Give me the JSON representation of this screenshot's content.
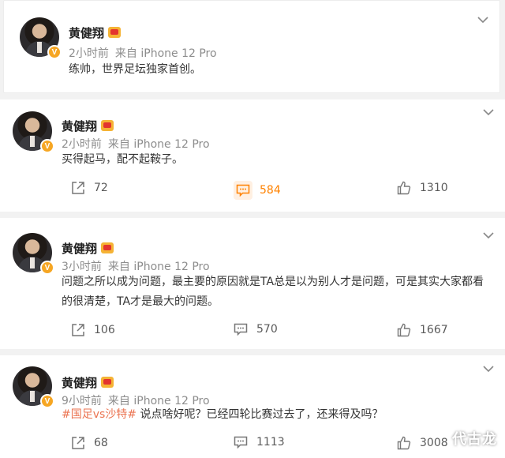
{
  "posts": [
    {
      "author": "黄健翔",
      "time": "2小时前",
      "source": "来自 iPhone 12 Pro",
      "content": "练帅，世界足坛独家首创。"
    },
    {
      "author": "黄健翔",
      "time": "2小时前",
      "source": "来自 iPhone 12 Pro",
      "content": "买得起马，配不起鞍子。",
      "shares": "72",
      "comments": "584",
      "likes": "1310"
    },
    {
      "author": "黄健翔",
      "time": "3小时前",
      "source": "来自 iPhone 12 Pro",
      "content_line1": "问题之所以成为问题，最主要的原因就是TA总是以为别人才是问题，可是其实大家都看",
      "content_line2": "的很清楚，TA才是最大的问题。",
      "shares": "106",
      "comments": "570",
      "likes": "1667"
    },
    {
      "author": "黄健翔",
      "time": "9小时前",
      "source": "来自 iPhone 12 Pro",
      "topic": "#国足vs沙特#",
      "content": " 说点啥好呢？已经四轮比赛过去了，还来得及吗？",
      "shares": "68",
      "comments": "1113",
      "likes": "3008"
    }
  ],
  "verify_badge": "V",
  "watermark": "代古龙",
  "colors": {
    "accent": "#ff8200",
    "topic": "#eb7350",
    "meta": "#8d8d8d",
    "badge": "#f6a623"
  },
  "icons": [
    "share-icon",
    "comment-icon",
    "like-icon",
    "chevron-down-icon",
    "verified-icon",
    "member-icon"
  ]
}
